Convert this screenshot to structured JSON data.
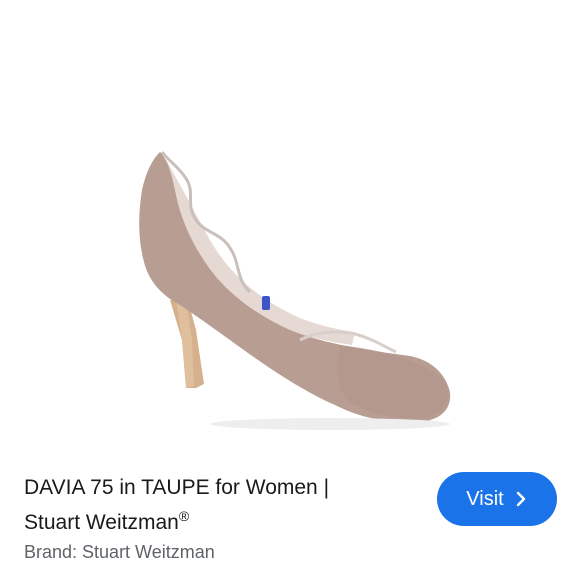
{
  "product": {
    "title_line1": "DAVIA 75 in TAUPE for Women |",
    "title_line2": "Stuart Weitzman",
    "registered_mark": "®",
    "brand_line": "Brand: Stuart Weitzman",
    "image_icon": "taupe-pump-shoe-image"
  },
  "actions": {
    "visit_label": "Visit",
    "visit_icon": "chevron-right-icon"
  },
  "colors": {
    "accent": "#1a73e8",
    "shoe_suede": "#b9a096",
    "heel": "#d7b38f"
  }
}
